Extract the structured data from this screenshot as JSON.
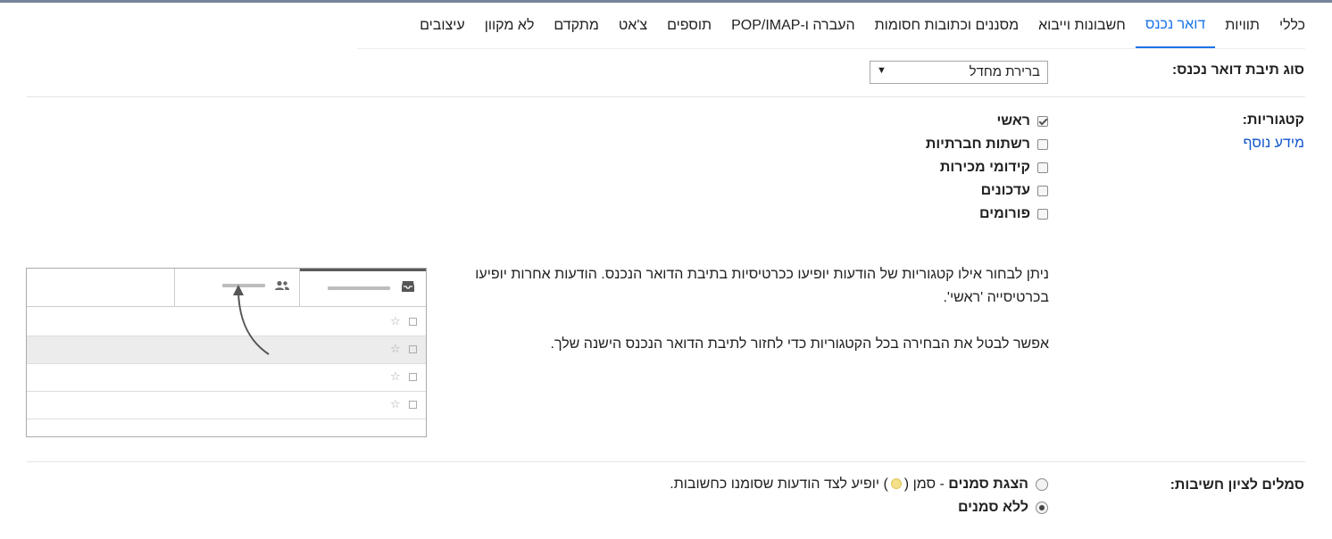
{
  "tabs": [
    {
      "label": "כללי"
    },
    {
      "label": "תוויות"
    },
    {
      "label": "דואר נכנס",
      "active": true
    },
    {
      "label": "חשבונות וייבוא"
    },
    {
      "label": "מסננים וכתובות חסומות"
    },
    {
      "label": "העברה ו-POP/IMAP"
    },
    {
      "label": "תוספים"
    },
    {
      "label": "צ'אט"
    },
    {
      "label": "מתקדם"
    },
    {
      "label": "לא מקוון"
    },
    {
      "label": "עיצובים"
    }
  ],
  "inbox_type": {
    "label": "סוג תיבת דואר נכנס:",
    "selected": "ברירת מחדל"
  },
  "categories": {
    "label": "קטגוריות:",
    "learn_more": "מידע נוסף",
    "items": [
      {
        "label": "ראשי",
        "checked": true
      },
      {
        "label": "רשתות חברתיות",
        "checked": false
      },
      {
        "label": "קידומי מכירות",
        "checked": false
      },
      {
        "label": "עדכונים",
        "checked": false
      },
      {
        "label": "פורומים",
        "checked": false
      }
    ],
    "description_1": "ניתן לבחור אילו קטגוריות של הודעות יופיעו ככרטיסיות בתיבת הדואר הנכנס. הודעות אחרות יופיעו בכרטיסייה 'ראשי'.",
    "description_2": "אפשר לבטל את הבחירה בכל הקטגוריות כדי לחזור לתיבת הדואר הנכנס הישנה שלך."
  },
  "importance": {
    "label": "סמלים לציון חשיבות:",
    "option_show_bold": "הצגת סמנים",
    "option_show_rest_1": " - סמן (",
    "option_show_rest_2": ") יופיע לצד הודעות שסומנו כחשובות.",
    "option_show_checked": false,
    "option_none": "ללא סמנים",
    "option_none_checked": true
  },
  "colors": {
    "accent": "#1a73e8",
    "link": "#1155cc",
    "top_border": "#76859a",
    "importance_marker": "#f4df8a"
  }
}
